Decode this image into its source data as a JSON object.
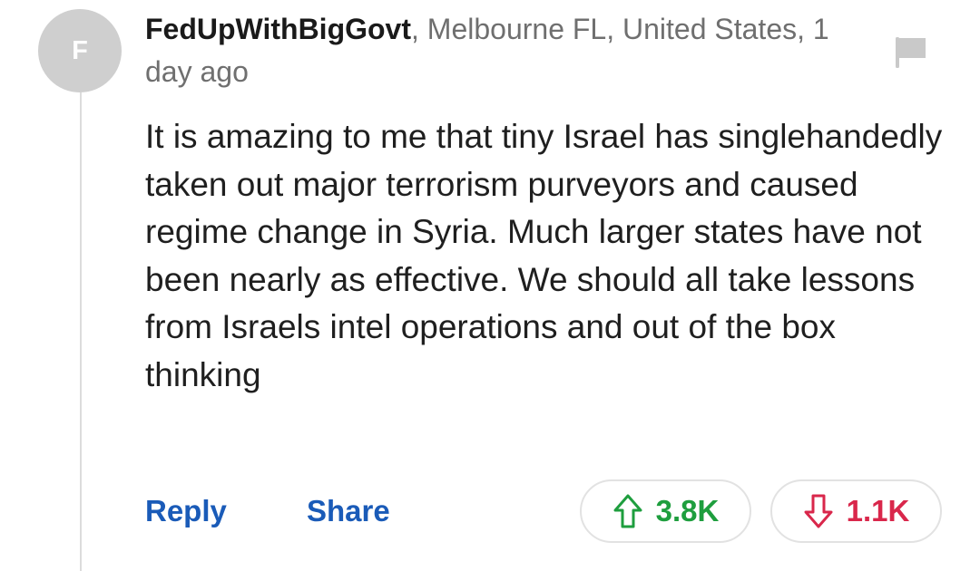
{
  "comment": {
    "avatar_letter": "F",
    "username": "FedUpWithBigGovt",
    "meta_suffix": ", Melbourne FL, United States, 1 day ago",
    "body": "It is amazing to me that tiny Israel has singlehandedly taken out major terrorism purveyors and caused regime change in Syria. Much larger states have not been nearly as effective. We should all take lessons from Israels intel operations and out of the box thinking"
  },
  "actions": {
    "reply_label": "Reply",
    "share_label": "Share",
    "upvote_count": "3.8K",
    "downvote_count": "1.1K"
  },
  "icons": {
    "flag": "flag-icon",
    "upvote": "arrow-up-icon",
    "downvote": "arrow-down-icon"
  },
  "colors": {
    "link": "#1a5bb8",
    "upvote": "#1e9e3e",
    "downvote": "#d9274b",
    "avatar": "#cfcfcf"
  }
}
